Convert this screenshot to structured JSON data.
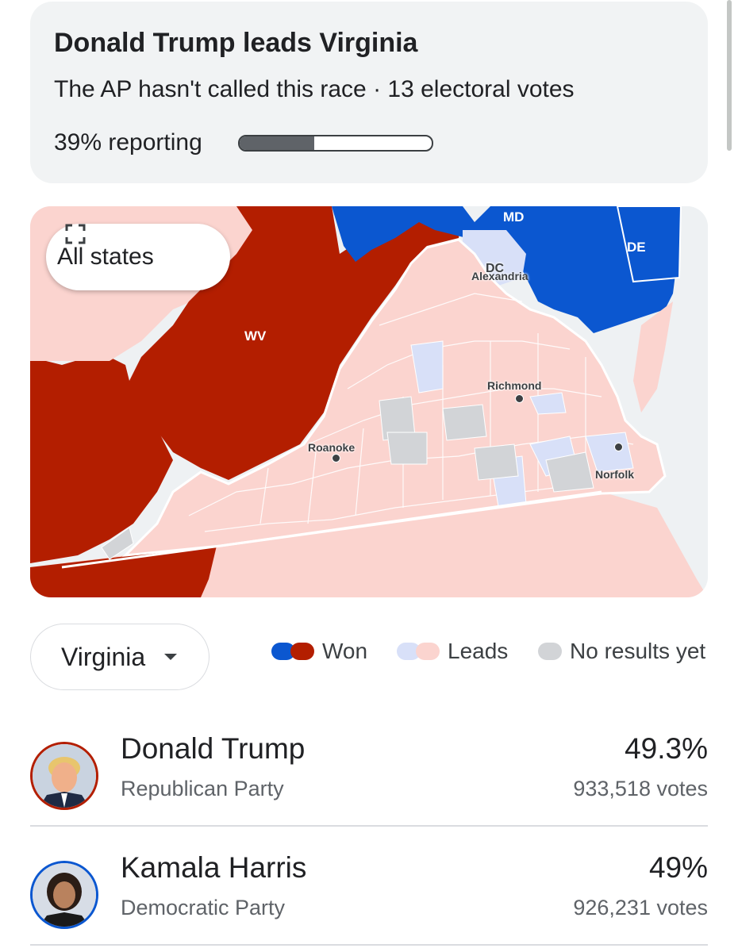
{
  "summary": {
    "title": "Donald Trump leads Virginia",
    "status": "The AP hasn't called this race · 13 electoral votes",
    "reporting_label": "39% reporting",
    "reporting_fraction": 0.39
  },
  "map": {
    "all_states_label": "All states",
    "state_labels": {
      "wv": "WV",
      "md": "MD",
      "de": "DE",
      "dc": "DC"
    },
    "city_labels": {
      "alexandria": "Alexandria",
      "richmond": "Richmond",
      "roanoke": "Roanoke",
      "norfolk": "Norfolk"
    },
    "colors": {
      "won_dem": "#0b57d0",
      "won_rep": "#b31e00",
      "leads_dem": "#d8e0f8",
      "leads_rep": "#fbd4cf",
      "no_results": "#d2d4d7",
      "water": "#eef1f3"
    }
  },
  "selector": {
    "value": "Virginia"
  },
  "legend": {
    "won_label": "Won",
    "leads_label": "Leads",
    "no_results_label": "No results yet"
  },
  "candidates": [
    {
      "name": "Donald Trump",
      "party": "Republican Party",
      "percent": "49.3%",
      "votes": "933,518 votes"
    },
    {
      "name": "Kamala Harris",
      "party": "Democratic Party",
      "percent": "49%",
      "votes": "926,231 votes"
    }
  ]
}
